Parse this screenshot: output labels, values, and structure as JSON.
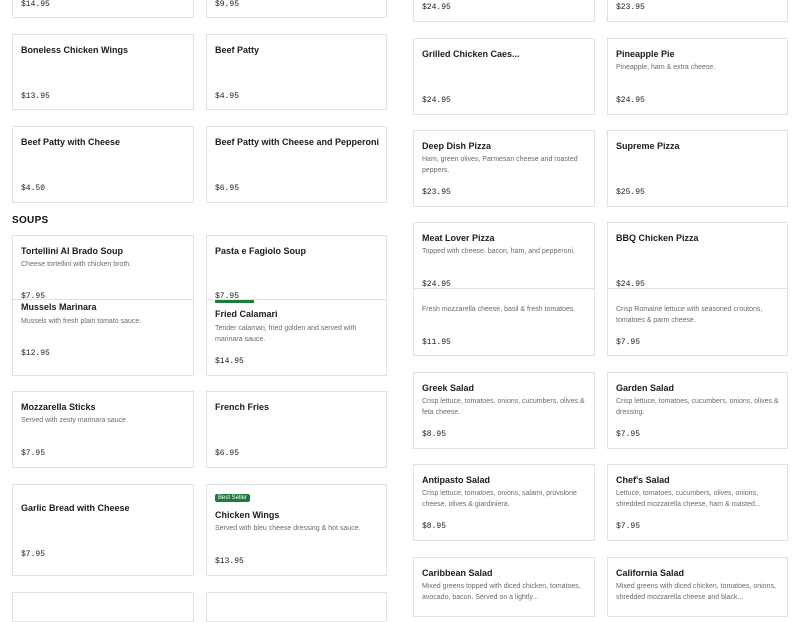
{
  "section_title": "SOUPS",
  "cards": [
    {
      "id": "c-top-1",
      "name": "",
      "desc": "",
      "price": "$14.95"
    },
    {
      "id": "c-top-2",
      "name": "",
      "desc": "",
      "price": "$9.95"
    },
    {
      "id": "c-boneless",
      "name": "Boneless Chicken Wings",
      "desc": "",
      "price": "$13.95"
    },
    {
      "id": "c-beef-patty",
      "name": "Beef Patty",
      "desc": "",
      "price": "$4.95"
    },
    {
      "id": "c-beef-cheese",
      "name": "Beef Patty with Cheese",
      "desc": "",
      "price": "$4.50"
    },
    {
      "id": "c-beef-cheese-pep",
      "name": "Beef Patty with Cheese and Pepperoni",
      "desc": "",
      "price": "$6.95"
    },
    {
      "id": "c-tortellini",
      "name": "Tortellini Al Brado Soup",
      "desc": "Cheese tortellini with chicken broth.",
      "price": "$7.95"
    },
    {
      "id": "c-pasta-fagiolo",
      "name": "Pasta e Fagiolo Soup",
      "desc": "",
      "price": "$7.95"
    },
    {
      "id": "c-mussels",
      "name": "Mussels Marinara",
      "desc": "Mussels with fresh plain tomato sauce.",
      "price": "$12.95"
    },
    {
      "id": "c-calamari",
      "name": "Fried Calamari",
      "desc": "Tender calamari, fried golden and served with marinara sauce.",
      "price": "$14.95"
    },
    {
      "id": "c-mozz",
      "name": "Mozzarella Sticks",
      "desc": "Served with zesty marinara sauce.",
      "price": "$7.95"
    },
    {
      "id": "c-fries",
      "name": "French Fries",
      "desc": "",
      "price": "$6.95"
    },
    {
      "id": "c-garlic",
      "name": "Garlic Bread with Cheese",
      "desc": "",
      "price": "$7.95"
    },
    {
      "id": "c-wings",
      "name": "Chicken Wings",
      "desc": "Served with bleu cheese dressing & hot sauce.",
      "price": "$13.95",
      "badge": "Best Seller"
    },
    {
      "id": "c-right-top-1",
      "name": "",
      "desc": "",
      "price": "$24.95"
    },
    {
      "id": "c-right-top-2",
      "name": "",
      "desc": "",
      "price": "$23.95"
    },
    {
      "id": "c-grilled-caes",
      "name": "Grilled Chicken Caes...",
      "desc": "",
      "price": "$24.95"
    },
    {
      "id": "c-pineapple",
      "name": "Pineapple Pie",
      "desc": "Pineapple, ham & extra cheese.",
      "price": "$24.95"
    },
    {
      "id": "c-deep-dish",
      "name": "Deep Dish Pizza",
      "desc": "Ham, green olives, Parmesan cheese and roasted peppers.",
      "price": "$23.95"
    },
    {
      "id": "c-supreme",
      "name": "Supreme Pizza",
      "desc": "",
      "price": "$25.95"
    },
    {
      "id": "c-meat-lover",
      "name": "Meat Lover Pizza",
      "desc": "Topped with cheese, bacon, ham, and pepperoni.",
      "price": "$24.95"
    },
    {
      "id": "c-bbq",
      "name": "BBQ Chicken Pizza",
      "desc": "",
      "price": "$24.95"
    },
    {
      "id": "c-caprese",
      "name": "",
      "desc": "Fresh mozzarella cheese, basil & fresh tomatoes.",
      "price": "$11.95"
    },
    {
      "id": "c-caesar",
      "name": "",
      "desc": "Crisp Romaine lettuce with seasoned croutons, tomatoes & parm cheese.",
      "price": "$7.95"
    },
    {
      "id": "c-greek",
      "name": "Greek Salad",
      "desc": "Crisp lettuce, tomatoes, onions, cucumbers, olives & feta cheese.",
      "price": "$8.95"
    },
    {
      "id": "c-garden",
      "name": "Garden Salad",
      "desc": "Crisp lettuce, tomatoes, cucumbers, onions, olives & dressing.",
      "price": "$7.95"
    },
    {
      "id": "c-antipasto",
      "name": "Antipasto Salad",
      "desc": "Crisp lettuce, tomatoes, onions, salami, provolone cheese, olives & giardiniera.",
      "price": "$8.95"
    },
    {
      "id": "c-chefs",
      "name": "Chef's Salad",
      "desc": "Lettuce, tomatoes, cucumbers, olives, onions, shredded mozzarella cheese, ham & roasted...",
      "price": "$7.95"
    },
    {
      "id": "c-caribbean",
      "name": "Caribbean Salad",
      "desc": "Mixed greens topped with diced chicken, tomatoes, avocado, bacon. Served on a lightly...",
      "price": ""
    },
    {
      "id": "c-california",
      "name": "California Salad",
      "desc": "Mixed greens with diced chicken, tomatoes, onions, shredded mozzarella cheese and black...",
      "price": ""
    }
  ]
}
